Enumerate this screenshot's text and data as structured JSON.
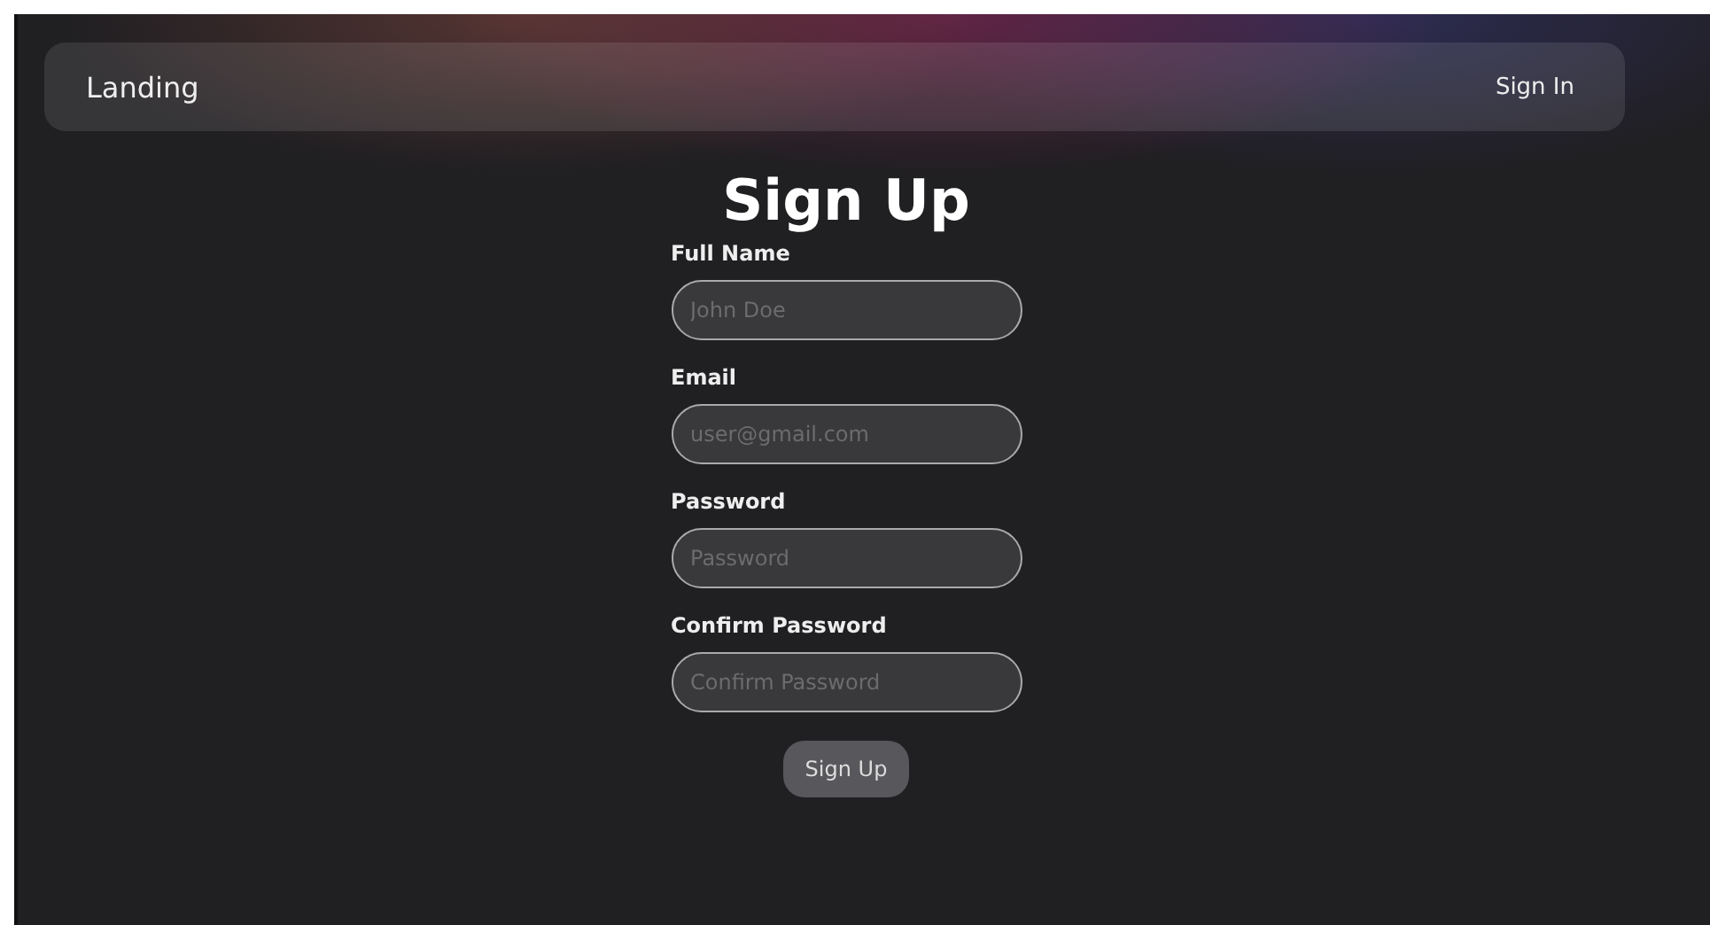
{
  "navbar": {
    "brand": "Landing",
    "link": "Sign In"
  },
  "title": "Sign Up",
  "fields": [
    {
      "label": "Full Name",
      "placeholder": "John Doe"
    },
    {
      "label": "Email",
      "placeholder": "user@gmail.com"
    },
    {
      "label": "Password",
      "placeholder": "Password"
    },
    {
      "label": "Confirm Password",
      "placeholder": "Confirm Password"
    }
  ],
  "submit": "Sign Up"
}
